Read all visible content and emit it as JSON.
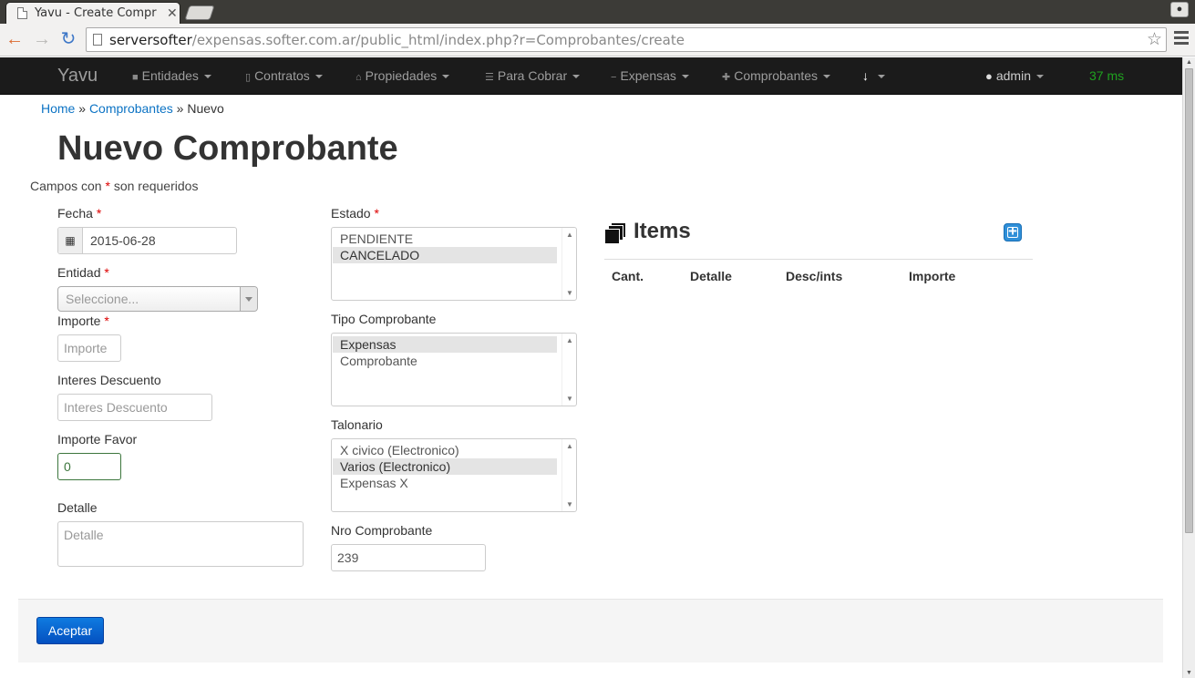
{
  "browser": {
    "tab_title": "Yavu - Create Compr",
    "tab_close": "✕",
    "url_host": "serversofter",
    "url_path": "/expensas.softer.com.ar/public_html/index.php?r=Comprobantes/create"
  },
  "navbar": {
    "brand": "Yavu",
    "items": [
      {
        "label": "Entidades",
        "icon": "user-icon"
      },
      {
        "label": "Contratos",
        "icon": "file-icon"
      },
      {
        "label": "Propiedades",
        "icon": "home-icon"
      },
      {
        "label": "Para Cobrar",
        "icon": "list-icon"
      },
      {
        "label": "Expensas",
        "icon": "minus-icon"
      },
      {
        "label": "Comprobantes",
        "icon": "plus-icon"
      },
      {
        "label": "",
        "icon": "download-icon"
      }
    ],
    "user": "admin",
    "timer": "37 ms"
  },
  "breadcrumb": {
    "home": "Home",
    "sep1": "»",
    "section": "Comprobantes",
    "sep2": "»",
    "current": "Nuevo"
  },
  "page": {
    "title": "Nuevo Comprobante",
    "required_prefix": "Campos con",
    "required_star": "*",
    "required_suffix": "son requeridos"
  },
  "form": {
    "fecha": {
      "label": "Fecha",
      "value": "2015-06-28"
    },
    "entidad": {
      "label": "Entidad",
      "placeholder": "Seleccione..."
    },
    "importe": {
      "label": "Importe",
      "placeholder": "Importe"
    },
    "interes_descuento": {
      "label": "Interes Descuento",
      "placeholder": "Interes Descuento"
    },
    "importe_favor": {
      "label": "Importe Favor",
      "value": "0"
    },
    "detalle": {
      "label": "Detalle",
      "placeholder": "Detalle"
    },
    "estado": {
      "label": "Estado",
      "options": [
        "PENDIENTE",
        "CANCELADO"
      ],
      "selected": "CANCELADO"
    },
    "tipo_comprobante": {
      "label": "Tipo Comprobante",
      "options": [
        "Expensas",
        "Comprobante"
      ],
      "selected": "Expensas"
    },
    "talonario": {
      "label": "Talonario",
      "options": [
        "X civico (Electronico)",
        "Varios (Electronico)",
        "Expensas X"
      ],
      "selected": "Varios (Electronico)"
    },
    "nro_comprobante": {
      "label": "Nro Comprobante",
      "value": "239"
    },
    "submit_label": "Aceptar"
  },
  "items": {
    "title": "Items",
    "columns": [
      "Cant.",
      "Detalle",
      "Desc/ints",
      "Importe"
    ]
  },
  "colors": {
    "navbar_bg": "#1b1b1b",
    "link": "#0c73c4",
    "required": "#dd0000",
    "timer": "#1fa11f",
    "primary_button": "#0866d0"
  }
}
